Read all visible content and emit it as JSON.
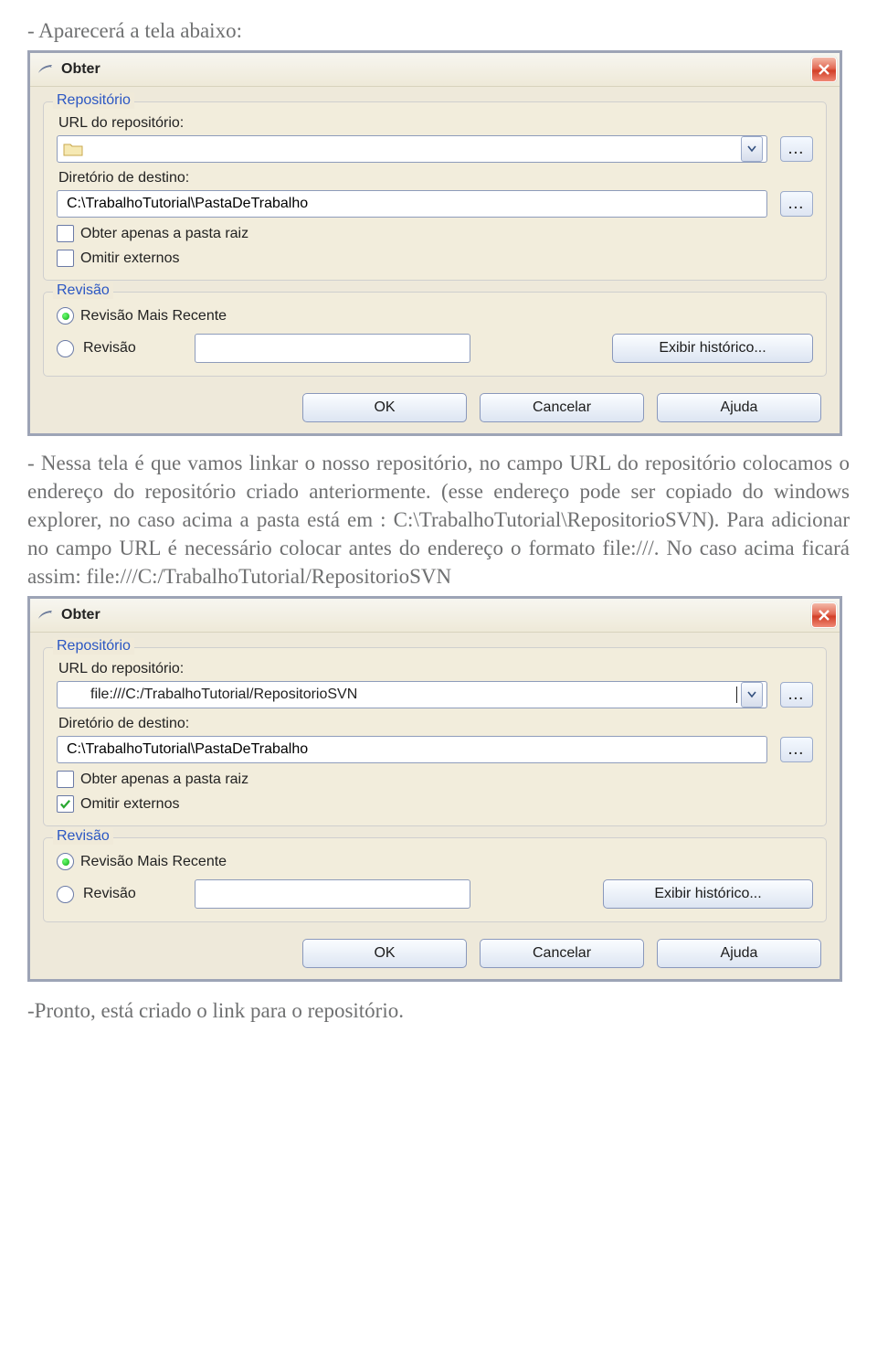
{
  "intro_text": "- Aparecerá a tela abaixo:",
  "dialog1": {
    "title": "Obter",
    "close_label": "Fechar",
    "group_repo": {
      "legend": "Repositório",
      "url_label": "URL do repositório:",
      "url_value": "",
      "dest_label": "Diretório de destino:",
      "dest_value": "C:\\TrabalhoTutorial\\PastaDeTrabalho",
      "check_only_root": "Obter apenas a pasta raiz",
      "only_root_checked": false,
      "check_omit_externals": "Omitir externos",
      "omit_externals_checked": false
    },
    "group_rev": {
      "legend": "Revisão",
      "radio_head": "Revisão Mais Recente",
      "radio_rev": "Revisão",
      "selected": "head",
      "rev_value": "",
      "history_btn": "Exibir histórico..."
    },
    "buttons": {
      "ok": "OK",
      "cancel": "Cancelar",
      "help": "Ajuda"
    },
    "browse_label": "..."
  },
  "mid_paragraph": "- Nessa tela é que vamos linkar o nosso repositório, no campo URL do repositório colocamos o endereço do repositório criado anteriormente. (esse endereço pode ser copiado do windows explorer, no caso acima a pasta está em : C:\\TrabalhoTutorial\\RepositorioSVN). Para adicionar no campo URL é necessário colocar antes do endereço o formato file:///. No caso acima ficará assim: file:///C:/TrabalhoTutorial/RepositorioSVN",
  "dialog2": {
    "title": "Obter",
    "close_label": "Fechar",
    "group_repo": {
      "legend": "Repositório",
      "url_label": "URL do repositório:",
      "url_value": "file:///C:/TrabalhoTutorial/RepositorioSVN",
      "dest_label": "Diretório de destino:",
      "dest_value": "C:\\TrabalhoTutorial\\PastaDeTrabalho",
      "check_only_root": "Obter apenas a pasta raiz",
      "only_root_checked": false,
      "check_omit_externals": "Omitir externos",
      "omit_externals_checked": true
    },
    "group_rev": {
      "legend": "Revisão",
      "radio_head": "Revisão Mais Recente",
      "radio_rev": "Revisão",
      "selected": "head",
      "rev_value": "",
      "history_btn": "Exibir histórico..."
    },
    "buttons": {
      "ok": "OK",
      "cancel": "Cancelar",
      "help": "Ajuda"
    },
    "browse_label": "..."
  },
  "outro_text": "-Pronto, está criado o link para o repositório."
}
